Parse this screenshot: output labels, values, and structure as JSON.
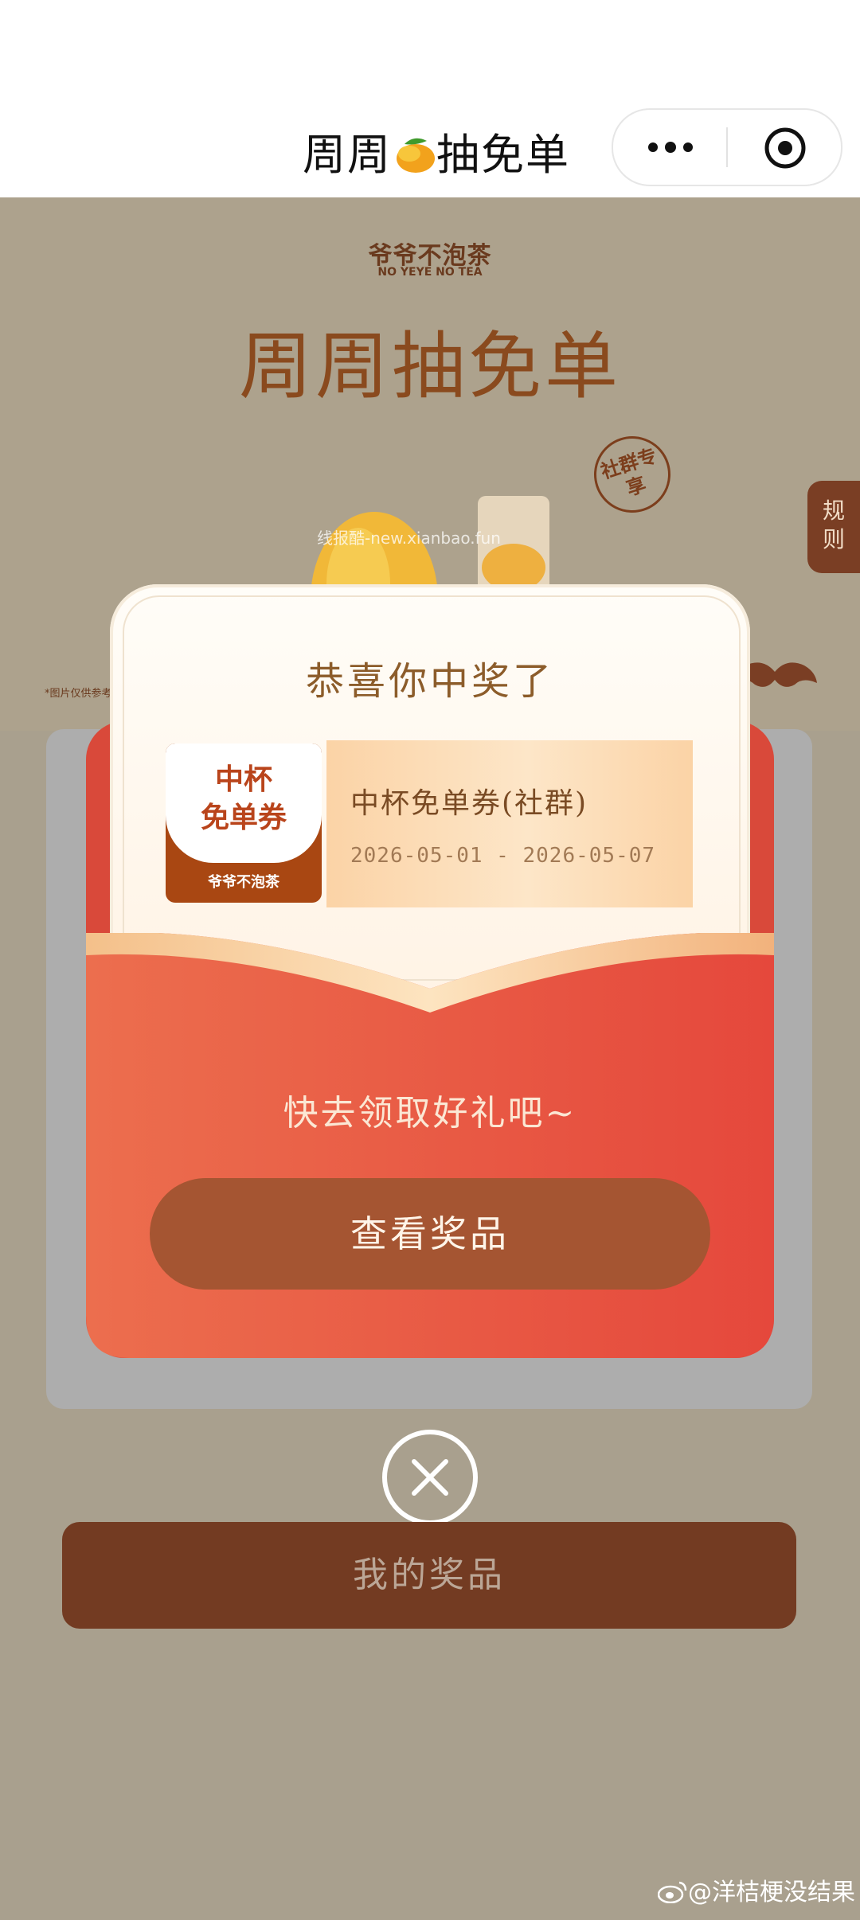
{
  "nav": {
    "title_part1": "周周",
    "title_part2": "抽免单",
    "more_icon": "more-dots-icon",
    "close_icon": "target-circle-icon"
  },
  "banner": {
    "brand_cn": "爷爷不泡茶",
    "brand_en": "NO YEYE NO TEA",
    "title": "周周抽免单",
    "stamp_text": "社群专享",
    "watermark": "线报酷-new.xianbao.fun",
    "disclaimer": "*图片仅供参考"
  },
  "rules_tab": {
    "label": "规则"
  },
  "modal": {
    "heading": "恭喜你中奖了",
    "coupon": {
      "badge": "中杯\n免单券",
      "badge_brand": "爷爷不泡茶",
      "title": "中杯免单券(社群)",
      "dates": "2026-05-01 - 2026-05-07"
    },
    "prompt": "快去领取好礼吧~",
    "view_button": "查看奖品",
    "close_icon": "close-icon"
  },
  "my_prizes_button": "我的奖品",
  "footer_credit": "@洋桔梗没结果",
  "colors": {
    "page_bg": "#a9a08e",
    "envelope_red": "#e5513f",
    "button_brown": "#a55532",
    "my_prize_brown": "#733b22"
  }
}
